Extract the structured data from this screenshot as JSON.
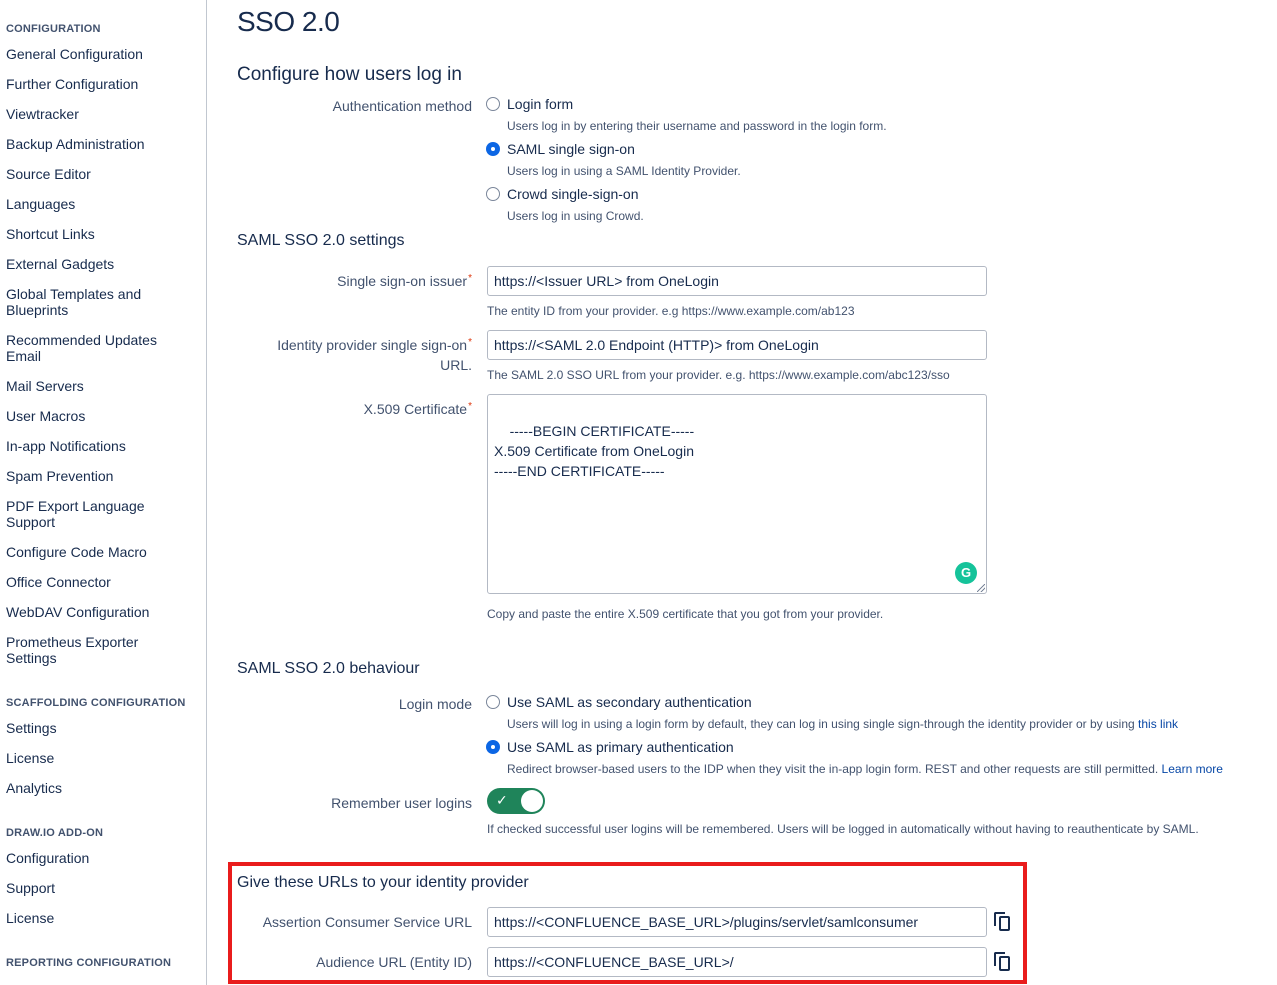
{
  "sidebar": {
    "sections": [
      {
        "heading": "CONFIGURATION",
        "items": [
          "General Configuration",
          "Further Configuration",
          "Viewtracker",
          "Backup Administration",
          "Source Editor",
          "Languages",
          "Shortcut Links",
          "External Gadgets",
          "Global Templates and Blueprints",
          "Recommended Updates Email",
          "Mail Servers",
          "User Macros",
          "In-app Notifications",
          "Spam Prevention",
          "PDF Export Language Support",
          "Configure Code Macro",
          "Office Connector",
          "WebDAV Configuration",
          "Prometheus Exporter Settings"
        ]
      },
      {
        "heading": "SCAFFOLDING CONFIGURATION",
        "items": [
          "Settings",
          "License",
          "Analytics"
        ]
      },
      {
        "heading": "DRAW.IO ADD-ON",
        "items": [
          "Configuration",
          "Support",
          "License"
        ]
      },
      {
        "heading": "REPORTING CONFIGURATION",
        "items": []
      }
    ]
  },
  "main": {
    "title": "SSO 2.0",
    "login_section": {
      "heading": "Configure how users log in",
      "auth_label": "Authentication method",
      "options": [
        {
          "label": "Login form",
          "desc": "Users log in by entering their username and password in the login form.",
          "checked": false
        },
        {
          "label": "SAML single sign-on",
          "desc": "Users log in using a SAML Identity Provider.",
          "checked": true
        },
        {
          "label": "Crowd single-sign-on",
          "desc": "Users log in using Crowd.",
          "checked": false
        }
      ]
    },
    "settings_section": {
      "heading": "SAML SSO 2.0 settings",
      "issuer_label": "Single sign-on issuer",
      "issuer_value": "https://<Issuer URL> from OneLogin",
      "issuer_help": "The entity ID from your provider. e.g https://www.example.com/ab123",
      "idp_url_label_line1": "Identity provider single sign-on",
      "idp_url_label_line2": "URL.",
      "idp_url_value": "https://<SAML 2.0 Endpoint (HTTP)> from OneLogin",
      "idp_url_help": "The SAML 2.0 SSO URL from your provider. e.g. https://www.example.com/abc123/sso",
      "cert_label": "X.509 Certificate",
      "cert_value": "-----BEGIN CERTIFICATE-----\nX.509 Certificate from OneLogin\n-----END CERTIFICATE-----",
      "cert_help": "Copy and paste the entire X.509 certificate that you got from your provider.",
      "required_mark": "*"
    },
    "behaviour_section": {
      "heading": "SAML SSO 2.0 behaviour",
      "login_mode_label": "Login mode",
      "options": [
        {
          "label": "Use SAML as secondary authentication",
          "desc": "Users will log in using a login form by default, they can log in using single sign-through the identity provider or by using ",
          "link": "this link",
          "checked": false
        },
        {
          "label": "Use SAML as primary authentication",
          "desc": "Redirect browser-based users to the IDP when they visit the in-app login form. REST and other requests are still permitted. ",
          "link": "Learn more",
          "checked": true
        }
      ],
      "remember_label": "Remember user logins",
      "remember_enabled": true,
      "remember_help": "If checked successful user logins will be remembered. Users will be logged in automatically without having to reauthenticate by SAML."
    },
    "idp_urls_section": {
      "heading": "Give these URLs to your identity provider",
      "acs_label": "Assertion Consumer Service URL",
      "acs_value": "https://<CONFLUENCE_BASE_URL>/plugins/servlet/samlconsumer",
      "audience_label": "Audience URL (Entity ID)",
      "audience_value": "https://<CONFLUENCE_BASE_URL>/",
      "copy_icon": "copy-icon"
    }
  },
  "colors": {
    "accent": "#0c66e4",
    "toggle_on": "#1f845a",
    "highlight": "#e91c1c",
    "link": "#0747a6",
    "grammarly": "#15c39a"
  }
}
